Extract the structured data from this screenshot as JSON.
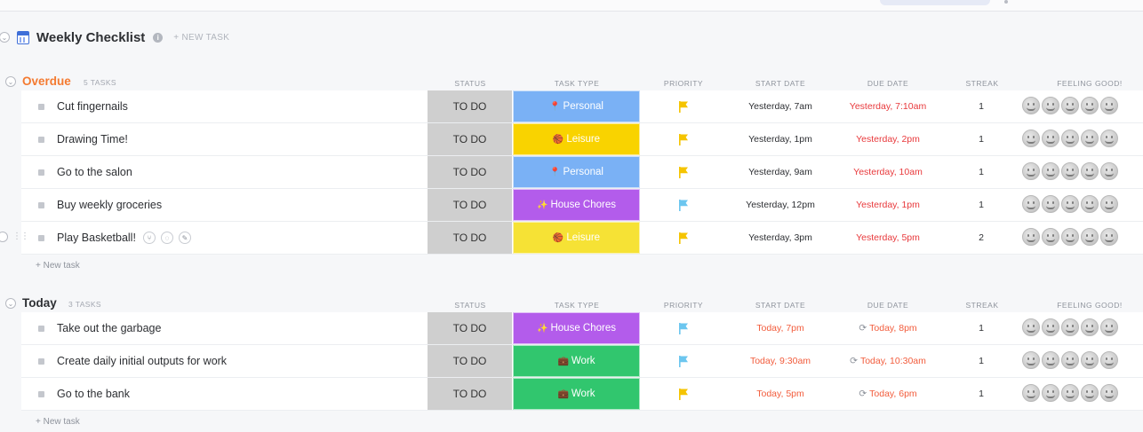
{
  "colors": {
    "overdue": "#f47a30",
    "today": "#2d2f33",
    "due_overdue": "#e8393c",
    "due_today": "#f25c3c",
    "start_today": "#f25c3c",
    "flag_yellow": "#f5c400",
    "flag_blue": "#6cc6ef",
    "personal": "#7ab1f5",
    "leisure": "#f9d300",
    "leisure_alt": "#f6e235",
    "house": "#b35ceb",
    "work": "#31c66e"
  },
  "list": {
    "title": "Weekly Checklist",
    "new_task_label": "+ NEW TASK",
    "info_icon": "i"
  },
  "columns": {
    "status": "STATUS",
    "task_type": "TASK TYPE",
    "priority": "PRIORITY",
    "start_date": "START DATE",
    "due_date": "DUE DATE",
    "streak": "STREAK",
    "feeling": "FEELING GOOD!"
  },
  "groups": [
    {
      "name": "Overdue",
      "count": "5 TASKS",
      "new_task": "+ New task",
      "tasks": [
        {
          "name": "Cut fingernails",
          "status": "TO DO",
          "type": "Personal",
          "type_icon": "📍",
          "type_color": "#7ab1f5",
          "priority": "yellow",
          "start": "Yesterday, 7am",
          "due": "Yesterday, 7:10am",
          "streak": "1"
        },
        {
          "name": "Drawing Time!",
          "status": "TO DO",
          "type": "Leisure",
          "type_icon": "🏀",
          "type_color": "#f9d300",
          "priority": "yellow",
          "start": "Yesterday, 1pm",
          "due": "Yesterday, 2pm",
          "streak": "1"
        },
        {
          "name": "Go to the salon",
          "status": "TO DO",
          "type": "Personal",
          "type_icon": "📍",
          "type_color": "#7ab1f5",
          "priority": "yellow",
          "start": "Yesterday, 9am",
          "due": "Yesterday, 10am",
          "streak": "1"
        },
        {
          "name": "Buy weekly groceries",
          "status": "TO DO",
          "type": "House Chores",
          "type_icon": "✨",
          "type_color": "#b35ceb",
          "priority": "blue",
          "start": "Yesterday, 12pm",
          "due": "Yesterday, 1pm",
          "streak": "1"
        },
        {
          "name": "Play Basketball!",
          "status": "TO DO",
          "type": "Leisure",
          "type_icon": "🏀",
          "type_color": "#f6e235",
          "priority": "yellow",
          "start": "Yesterday, 3pm",
          "due": "Yesterday, 5pm",
          "streak": "2"
        }
      ]
    },
    {
      "name": "Today",
      "count": "3 TASKS",
      "new_task": "+ New task",
      "tasks": [
        {
          "name": "Take out the garbage",
          "status": "TO DO",
          "type": "House Chores",
          "type_icon": "✨",
          "type_color": "#b35ceb",
          "priority": "blue",
          "start": "Today, 7pm",
          "due": "Today, 8pm",
          "streak": "1"
        },
        {
          "name": "Create daily initial outputs for work",
          "status": "TO DO",
          "type": "Work",
          "type_icon": "💼",
          "type_color": "#31c66e",
          "priority": "blue",
          "start": "Today, 9:30am",
          "due": "Today, 10:30am",
          "streak": "1"
        },
        {
          "name": "Go to the bank",
          "status": "TO DO",
          "type": "Work",
          "type_icon": "💼",
          "type_color": "#31c66e",
          "priority": "yellow",
          "start": "Today, 5pm",
          "due": "Today, 6pm",
          "streak": "1"
        }
      ]
    }
  ],
  "icons": {
    "toggle": "collapse-toggle-icon",
    "calendar": "calendar-list-icon",
    "task_square": "task-status-square-icon",
    "flag": "priority-flag-icon",
    "recurring": "recurring-icon",
    "face": "smiley-face-icon",
    "subtask": "subtask-icon",
    "tag": "tag-icon",
    "edit": "pencil-icon"
  },
  "recurring_glyph": "⟳",
  "row_tools": {
    "subtask": "⑂",
    "tag": "◌",
    "edit": "✎",
    "drag": "⋮⋮"
  }
}
